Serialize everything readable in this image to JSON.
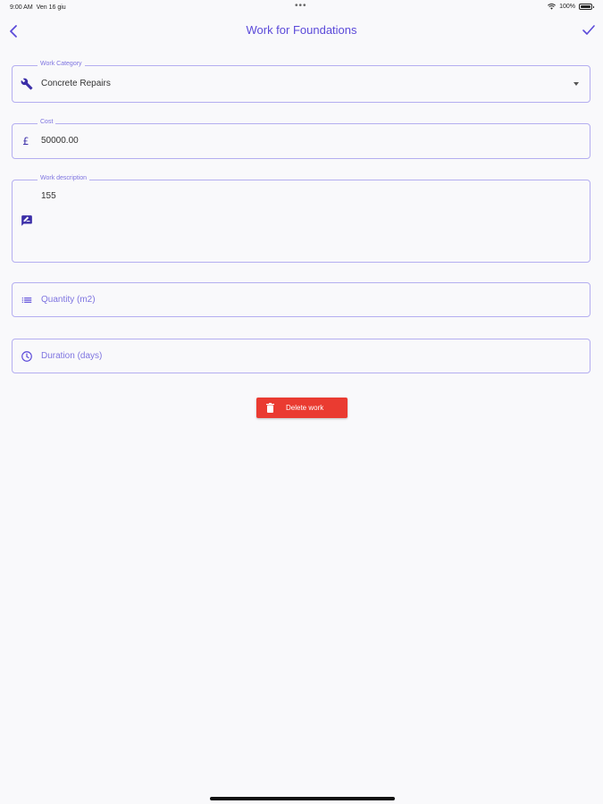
{
  "status_bar": {
    "time": "9:00 AM",
    "date": "Ven 16 giu",
    "battery": "100%"
  },
  "nav": {
    "title": "Work for Foundations"
  },
  "fields": {
    "work_category": {
      "label": "Work Category",
      "value": "Concrete Repairs"
    },
    "cost": {
      "label": "Cost",
      "value": "50000.00"
    },
    "work_description": {
      "label": "Work description",
      "value": "155"
    },
    "quantity": {
      "placeholder": "Quantity (m2)"
    },
    "duration": {
      "placeholder": "Duration (days)"
    }
  },
  "delete_button": {
    "label": "Delete work"
  },
  "colors": {
    "accent": "#5b4ad9",
    "border": "#b4aef0",
    "danger": "#ea3b31"
  }
}
